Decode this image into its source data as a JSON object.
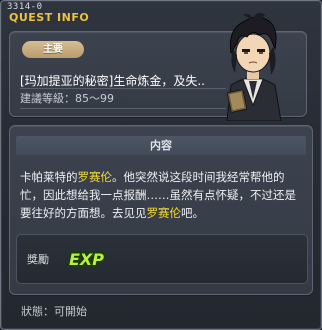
{
  "window": {
    "quest_id": "3314-0",
    "title": "QUEST INFO"
  },
  "summary": {
    "category": "主要",
    "quest_name": "[玛加提亚的秘密]生命炼金，及失..",
    "level_requirement": "建議等級：85～99"
  },
  "content": {
    "header": "内容",
    "segments": [
      {
        "text": "卡帕莱特的",
        "highlight": false
      },
      {
        "text": "罗赛伦",
        "highlight": true
      },
      {
        "text": "。他突然说这段时间我经常帮他的忙，因此想给我一点报酬……虽然有点怀疑，不过还是要往好的方面想。去见见",
        "highlight": false
      },
      {
        "text": "罗赛伦",
        "highlight": true
      },
      {
        "text": "吧。",
        "highlight": false
      }
    ],
    "reward_label": "獎勵",
    "reward_icon": "exp-icon"
  },
  "status": {
    "text": "狀態：可開始"
  },
  "colors": {
    "title": "#f2c040",
    "highlight": "#f3dc30",
    "badge": "#c9ad7c",
    "exp_text": "#b6f23a"
  }
}
